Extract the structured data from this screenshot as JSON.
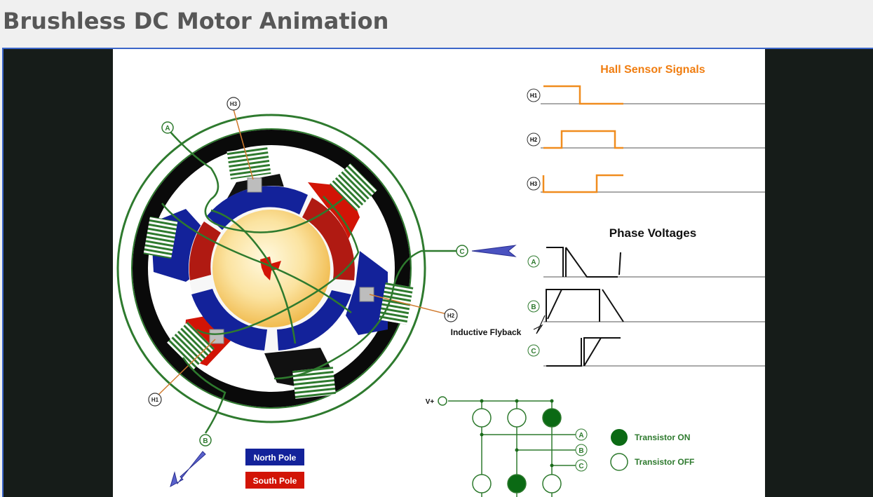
{
  "page": {
    "title": "Brushless DC Motor Animation"
  },
  "diagram": {
    "hall_title": "Hall Sensor Signals",
    "phase_title": "Phase Voltages",
    "flyback_label": "Inductive Flyback",
    "hall_labels": [
      "H1",
      "H2",
      "H3"
    ],
    "phase_labels": [
      "A",
      "B",
      "C"
    ],
    "supply_label": "V+",
    "legend": {
      "north": "North Pole",
      "south": "South Pole"
    },
    "transistor_legend": {
      "on": "Transistor ON",
      "off": "Transistor OFF"
    },
    "transistors": {
      "top": [
        "off",
        "off",
        "on"
      ],
      "bottom": [
        "off",
        "on",
        "off"
      ]
    },
    "colors": {
      "hall_signal": "#f08c1e",
      "wire": "#2e7a2e",
      "north": "#13229a",
      "south": "#d21406",
      "rotor": "#f4c25a",
      "hall_title": "#f07d10"
    }
  }
}
